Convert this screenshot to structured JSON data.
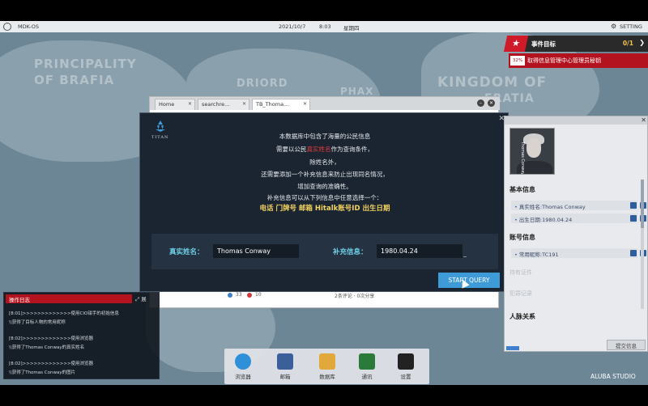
{
  "topbar": {
    "os_name": "MDK-OS",
    "date": "2021/10/7",
    "time": "8:03",
    "weekday": "星期四",
    "setting_label": "SETTING",
    "setting_icon": "gear-icon"
  },
  "map": {
    "regions": [
      "PRINCIPALITY",
      "OF BRAFIA",
      "DRIORD",
      "PHAX",
      "KINGDOM OF",
      "FRATIA"
    ]
  },
  "objective": {
    "title": "事件目标",
    "count": "0/1",
    "progress": "32%",
    "task": "取得信息管理中心管理员秘钥"
  },
  "browser": {
    "tabs": [
      {
        "label": "Home"
      },
      {
        "label": "searchre..."
      },
      {
        "label": "TB_Thoma..."
      }
    ],
    "footer": {
      "likes": "33",
      "dislikes": "10",
      "comments": "2条评论 · 0次分享"
    }
  },
  "dialog": {
    "logo_text": "TITAN",
    "intro_lines": [
      {
        "text": "本数据库中包含了海量的公民信息"
      },
      {
        "before": "需要以公民",
        "highlight": "真实姓名",
        "after": "作为查询条件，"
      },
      {
        "text": "除姓名外，"
      },
      {
        "text": "还需要添加一个补充信息来防止出现同名情况，"
      },
      {
        "text": "增加查询的准确性。"
      },
      {
        "text": "补充信息可以从下列信息中任意选择一个："
      }
    ],
    "options": "电话  门牌号  邮箱  Hitalk账号ID  出生日期",
    "name_label": "真实姓名：",
    "name_value": "Thomas Conway",
    "extra_label": "补充信息：",
    "extra_value": "1980.04.24",
    "start_button": "START QUERY"
  },
  "profile": {
    "avatar_caption": "Thomas Conway",
    "basic_title": "基本信息",
    "basic_fields": [
      {
        "label": "真实姓名:Thomas Conway"
      },
      {
        "label": "出生日期:1980.04.24"
      }
    ],
    "account_title": "账号信息",
    "account_fields": [
      {
        "label": "常用昵称:TC191"
      }
    ],
    "faded_items": [
      "持有证件",
      "犯罪记录"
    ],
    "relations_title": "人脉关系",
    "submit_button": "提交信息"
  },
  "log": {
    "title": "操作日志",
    "expand_label": "展",
    "lines": [
      "[8:01]>>>>>>>>>>>>>使用CIO钳手的初始信息",
      "\\\\获得了目标人物的常用昵称",
      "[8:02]>>>>>>>>>>>>>使用浏览器",
      "\\\\获得了Thomas Conway的真实姓名",
      "[8:02]>>>>>>>>>>>>>使用浏览器",
      "\\\\获得了Thomas Conway的图片"
    ]
  },
  "dock": {
    "items": [
      {
        "label": "浏览器",
        "icon": "globe-icon",
        "color": "#2f8fd8"
      },
      {
        "label": "邮箱",
        "icon": "mail-icon",
        "color": "#3a5f9a"
      },
      {
        "label": "数据库",
        "icon": "database-icon",
        "color": "#e0a93a"
      },
      {
        "label": "通讯",
        "icon": "shield-icon",
        "color": "#2a7a3a"
      },
      {
        "label": "设置",
        "icon": "gear-icon",
        "color": "#222222"
      }
    ]
  },
  "studio": "ALUBA STUDIO",
  "colors": {
    "accent_red": "#b3121f",
    "highlight_yellow": "#f4d35e",
    "label_cyan": "#6fd0e8",
    "button_blue": "#3f9bd8"
  }
}
